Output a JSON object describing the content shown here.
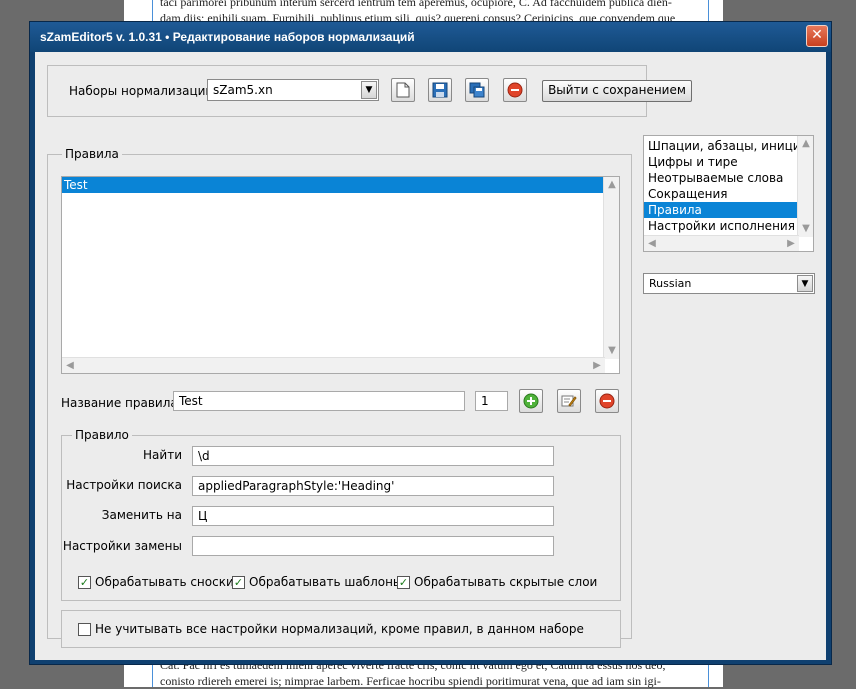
{
  "background_doc": {
    "top_line1": "taci parimorei pribunum interum sercerd ientrum tem aperemus, ocupiore, C. Ad facchuidem publica dien-",
    "top_line2": "dam diis; enihili suam. Furnihili, publinus etium sili, quis? quereni consus? Ceripicins, que convendem que",
    "bottom_line1": "Cat. Pac iiri es tumaedem mieni aperec viverte fracte cris, conic iit vatum ego et, Catum ta essus nos deo,",
    "bottom_line2": "conisto rdiereh emerei is; nimprae larbem. Ferficae hocribu spiendi poritimurat vena, que ad iam sin igi-"
  },
  "window": {
    "title": "sZamEditor5 v. 1.0.31 • Редактирование наборов нормализаций",
    "close_glyph": "✕"
  },
  "top_bar": {
    "sets_label": "Наборы нормализаций",
    "sets_value": "sZam5.xn",
    "exit_save_label": "Выйти с сохранением"
  },
  "rules": {
    "group_label": "Правила",
    "items": [
      "Test"
    ],
    "rule_name_label": "Название правила",
    "rule_name_value": "Test",
    "rule_index_value": "1"
  },
  "rule": {
    "group_label": "Правило",
    "find_label": "Найти",
    "find_value": "\\d",
    "search_settings_label": "Настройки поиска",
    "search_settings_value": "appliedParagraphStyle:'Heading'",
    "replace_label": "Заменить на",
    "replace_value": "Ц",
    "replace_settings_label": "Настройки замены",
    "replace_settings_value": "",
    "checkboxes": [
      {
        "label": "Обрабатывать сноски",
        "checked": true
      },
      {
        "label": "Обрабатывать шаблоны",
        "checked": true
      },
      {
        "label": "Обрабатывать скрытые слои",
        "checked": true
      }
    ]
  },
  "ignore_option": {
    "label": "Не учитывать все настройки нормализаций, кроме правил, в данном наборе",
    "checked": false
  },
  "categories": {
    "items": [
      "Шпации, абзацы, инициалы",
      "Цифры и тире",
      "Неотрываемые слова",
      "Сокращения",
      "Правила",
      "Настройки исполнения"
    ],
    "selected": "Правила"
  },
  "language": {
    "value": "Russian"
  },
  "colors": {
    "selection": "#0a84d6",
    "title_bar": "#104576",
    "close": "#c8401f"
  }
}
